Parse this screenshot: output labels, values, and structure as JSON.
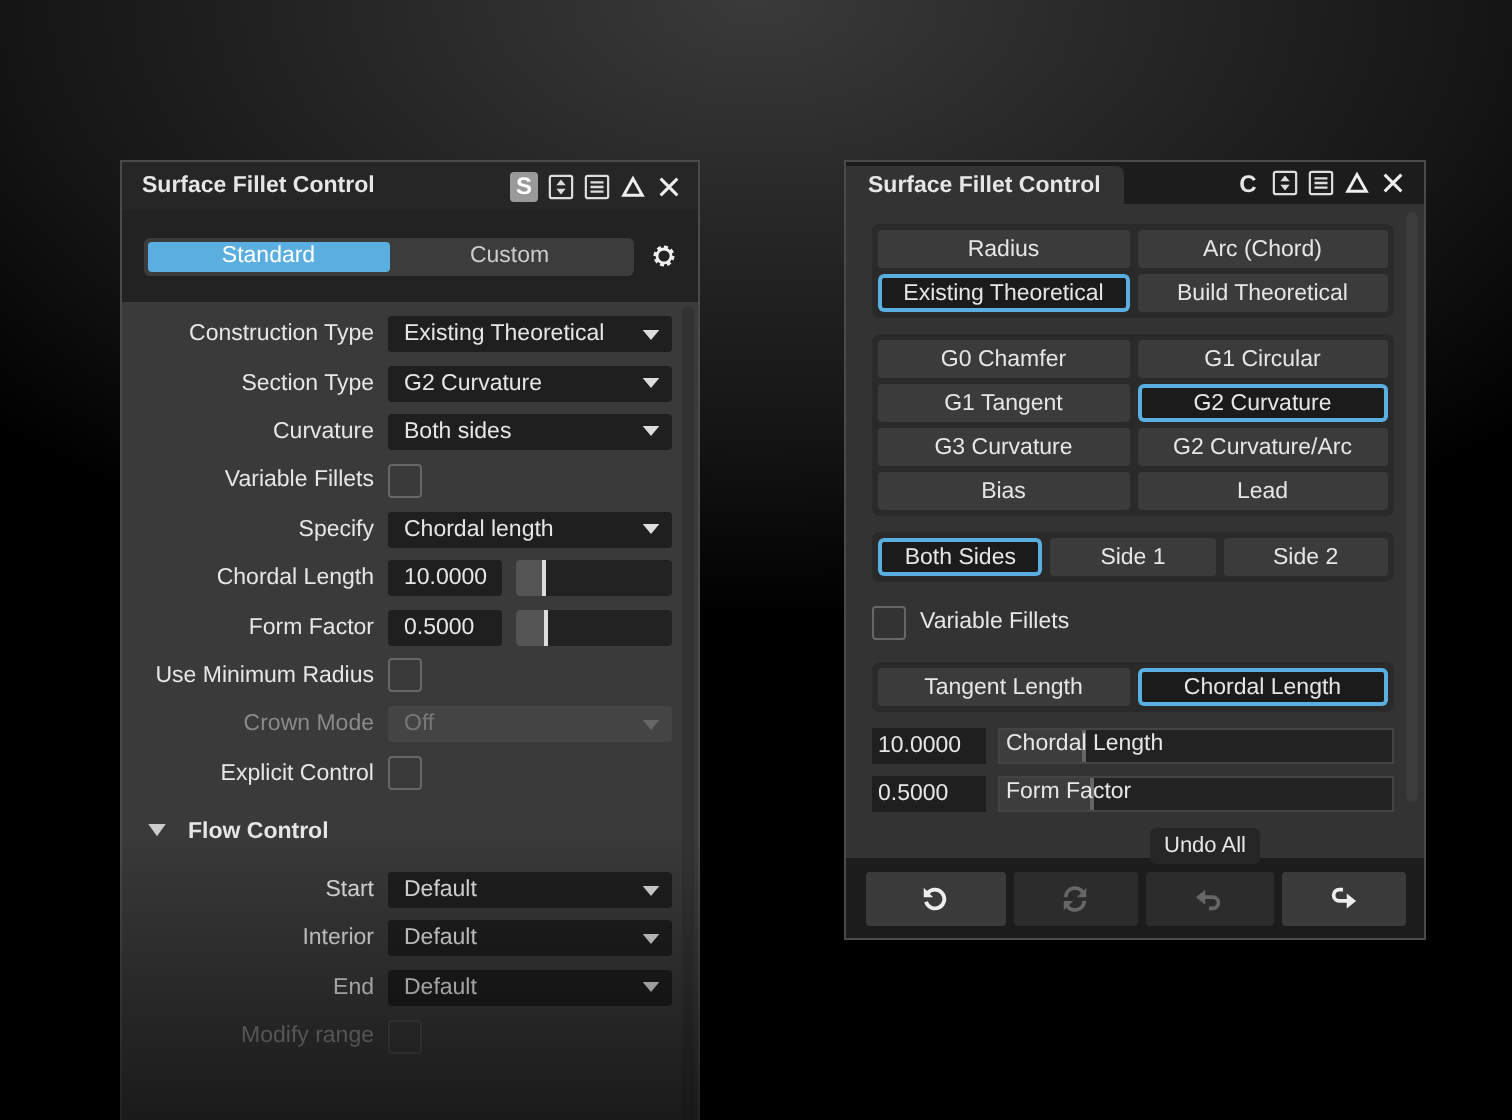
{
  "left_panel": {
    "title": "Surface Fillet Control",
    "mode_letter": "S",
    "mode_tabs": [
      {
        "label": "Standard",
        "selected": true
      },
      {
        "label": "Custom",
        "selected": false
      }
    ],
    "rows": [
      {
        "kind": "dropdown",
        "label": "Construction Type",
        "value": "Existing Theoretical",
        "disabled": false
      },
      {
        "kind": "dropdown",
        "label": "Section Type",
        "value": "G2 Curvature",
        "disabled": false
      },
      {
        "kind": "dropdown",
        "label": "Curvature",
        "value": "Both sides",
        "disabled": false
      },
      {
        "kind": "checkbox",
        "label": "Variable Fillets",
        "checked": false,
        "disabled": false
      },
      {
        "kind": "dropdown",
        "label": "Specify",
        "value": "Chordal length",
        "disabled": false
      },
      {
        "kind": "number",
        "label": "Chordal Length",
        "value": "10.0000",
        "level": 0.19,
        "disabled": false
      },
      {
        "kind": "number",
        "label": "Form Factor",
        "value": "0.5000",
        "level": 0.2,
        "disabled": false
      },
      {
        "kind": "checkbox",
        "label": "Use Minimum Radius",
        "checked": false,
        "disabled": false
      },
      {
        "kind": "dropdown",
        "label": "Crown Mode",
        "value": "Off",
        "disabled": true
      },
      {
        "kind": "checkbox",
        "label": "Explicit Control",
        "checked": false,
        "disabled": false
      }
    ],
    "section": {
      "title": "Flow Control",
      "expanded": true,
      "rows": [
        {
          "kind": "dropdown",
          "label": "Start",
          "value": "Default",
          "disabled": false
        },
        {
          "kind": "dropdown",
          "label": "Interior",
          "value": "Default",
          "disabled": false
        },
        {
          "kind": "dropdown",
          "label": "End",
          "value": "Default",
          "disabled": false
        },
        {
          "kind": "checkbox",
          "label": "Modify range",
          "checked": false,
          "disabled": true
        }
      ]
    }
  },
  "right_panel": {
    "title": "Surface Fillet Control",
    "mode_letter": "C",
    "button_groups": [
      [
        {
          "label": "Radius",
          "selected": false
        },
        {
          "label": "Arc (Chord)",
          "selected": false
        },
        {
          "label": "Existing Theoretical",
          "selected": true
        },
        {
          "label": "Build Theoretical",
          "selected": false
        }
      ],
      [
        {
          "label": "G0 Chamfer",
          "selected": false
        },
        {
          "label": "G1 Circular",
          "selected": false
        },
        {
          "label": "G1 Tangent",
          "selected": false
        },
        {
          "label": "G2 Curvature",
          "selected": true
        },
        {
          "label": "G3 Curvature",
          "selected": false
        },
        {
          "label": "G2 Curvature/Arc",
          "selected": false
        },
        {
          "label": "Bias",
          "selected": false
        },
        {
          "label": "Lead",
          "selected": false
        }
      ],
      [
        {
          "label": "Both Sides",
          "selected": true
        },
        {
          "label": "Side 1",
          "selected": false
        },
        {
          "label": "Side 2",
          "selected": false
        }
      ]
    ],
    "variable_fillets": {
      "label": "Variable Fillets",
      "checked": false
    },
    "length_buttons": [
      {
        "label": "Tangent Length",
        "selected": false
      },
      {
        "label": "Chordal Length",
        "selected": true
      }
    ],
    "values": [
      {
        "value": "10.0000",
        "label": "Chordal Length",
        "level": 0.22
      },
      {
        "value": "0.5000",
        "label": "Form Factor",
        "level": 0.24
      }
    ],
    "tooltip": "Undo All",
    "footer_buttons": [
      {
        "kind": "reset",
        "disabled": false
      },
      {
        "kind": "refresh",
        "disabled": true
      },
      {
        "kind": "undo",
        "disabled": true
      },
      {
        "kind": "redo",
        "disabled": false
      }
    ]
  }
}
